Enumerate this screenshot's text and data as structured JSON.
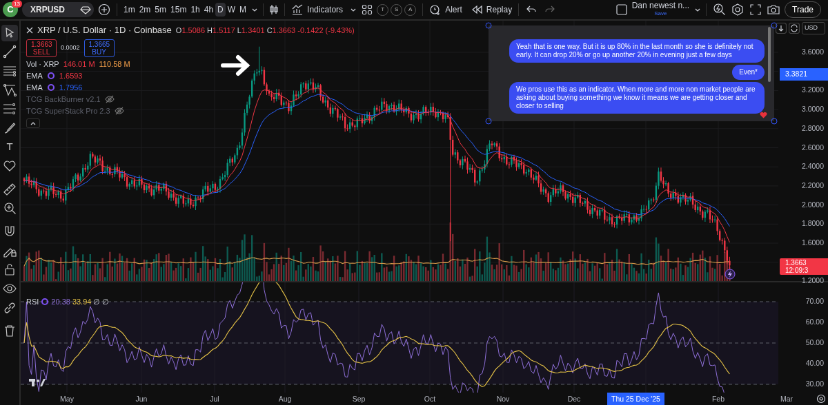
{
  "toolbar": {
    "avatar_letter": "C",
    "notifications": "13",
    "symbol": "XRPUSD",
    "intervals": [
      {
        "label": "1m",
        "selected": false
      },
      {
        "label": "2m",
        "selected": false
      },
      {
        "label": "5m",
        "selected": false
      },
      {
        "label": "15m",
        "selected": false
      },
      {
        "label": "1h",
        "selected": false
      },
      {
        "label": "4h",
        "selected": false
      },
      {
        "label": "D",
        "selected": true
      },
      {
        "label": "W",
        "selected": false
      },
      {
        "label": "M",
        "selected": false
      }
    ],
    "indicators_label": "Indicators",
    "quick_buttons": [
      "T",
      "S",
      "A"
    ],
    "alert_label": "Alert",
    "replay_label": "Replay",
    "layout_name": "Dan newest n...",
    "save_label": "Save",
    "trade_label": "Trade"
  },
  "drawing_tools": [
    {
      "kind": "cursor",
      "selected": true
    },
    {
      "kind": "trend-line",
      "selected": false
    },
    {
      "kind": "horizontal-lines",
      "selected": false
    },
    {
      "kind": "pattern",
      "selected": false
    },
    {
      "kind": "fib-lines",
      "selected": false
    },
    {
      "kind": "brush",
      "selected": false
    },
    {
      "kind": "text",
      "label": "T",
      "selected": false
    },
    {
      "kind": "heart",
      "selected": false
    },
    {
      "kind": "ruler",
      "selected": false
    },
    {
      "kind": "zoom",
      "selected": false
    },
    {
      "kind": "magnet",
      "selected": false
    },
    {
      "kind": "pencil-lock",
      "selected": false
    },
    {
      "kind": "lock",
      "selected": false
    },
    {
      "kind": "eye",
      "selected": false
    },
    {
      "kind": "link",
      "selected": false
    },
    {
      "kind": "trash",
      "selected": false
    }
  ],
  "legend": {
    "title": "XRP / U.S. Dollar · 1D · Coinbase",
    "ohlc": [
      {
        "label": "O",
        "value": "1.5086"
      },
      {
        "label": "H",
        "value": "1.5117"
      },
      {
        "label": "L",
        "value": "1.3401"
      },
      {
        "label": "C",
        "value": "1.3663"
      }
    ],
    "change": "-0.1422 (-9.43%)",
    "sell": {
      "price": "1.3663",
      "label": "SELL"
    },
    "spread": "0.0002",
    "buy": {
      "price": "1.3665",
      "label": "BUY"
    },
    "studies": [
      {
        "kind": "volume",
        "name": "Vol · XRP",
        "hidden": false,
        "values": [
          {
            "text": "146.01 M",
            "color": "#f23645"
          },
          {
            "text": "110.58 M",
            "color": "#f5a04a"
          }
        ]
      },
      {
        "kind": "ema",
        "name": "EMA",
        "hidden": false,
        "values": [
          {
            "text": "1.6593",
            "color": "#f23645"
          }
        ]
      },
      {
        "kind": "ema",
        "name": "EMA",
        "hidden": false,
        "values": [
          {
            "text": "1.7956",
            "color": "#2962ff"
          }
        ]
      },
      {
        "kind": "script",
        "name": "TCG BackBurner v2.1",
        "hidden": true
      },
      {
        "kind": "script",
        "name": "TCG SuperStack Pro 2.3",
        "hidden": true
      }
    ]
  },
  "chat_overlay": {
    "messages": [
      {
        "text": "Yeah that is one way. But it is up 80% in the last month so she is definitely not early. It can drop 20% or go up another 20% in evening just a few days",
        "reacted": false
      },
      {
        "text": "Even*",
        "reacted": false
      },
      {
        "text": "We pros use this as an indicator. When more and more non market people are asking about buying something we know it means we are getting closer and closer to selling",
        "reacted": true
      }
    ]
  },
  "price_axis": {
    "currency": "USD",
    "ticks": [
      "3.6000",
      "3.2000",
      "3.0000",
      "2.8000",
      "2.6000",
      "2.4000",
      "2.2000",
      "2.0000",
      "1.8000",
      "1.6000",
      "1.2000"
    ],
    "marker": "3.3821",
    "last_price": "1.3663",
    "countdown": "12:09:3"
  },
  "rsi": {
    "name": "RSI",
    "values": [
      {
        "text": "20.38",
        "color": "#8e6fd8"
      },
      {
        "text": "33.94",
        "color": "#e8c547"
      },
      {
        "text": "∅"
      },
      {
        "text": "∅"
      }
    ],
    "ticks": [
      "70.00",
      "60.00",
      "50.00",
      "40.00",
      "30.00"
    ]
  },
  "time_axis": {
    "labels": [
      "May",
      "Jun",
      "Jul",
      "Aug",
      "Sep",
      "Oct",
      "Nov",
      "Dec",
      "Feb",
      "Mar"
    ],
    "crosshair_label": "Thu 25 Dec '25"
  }
}
